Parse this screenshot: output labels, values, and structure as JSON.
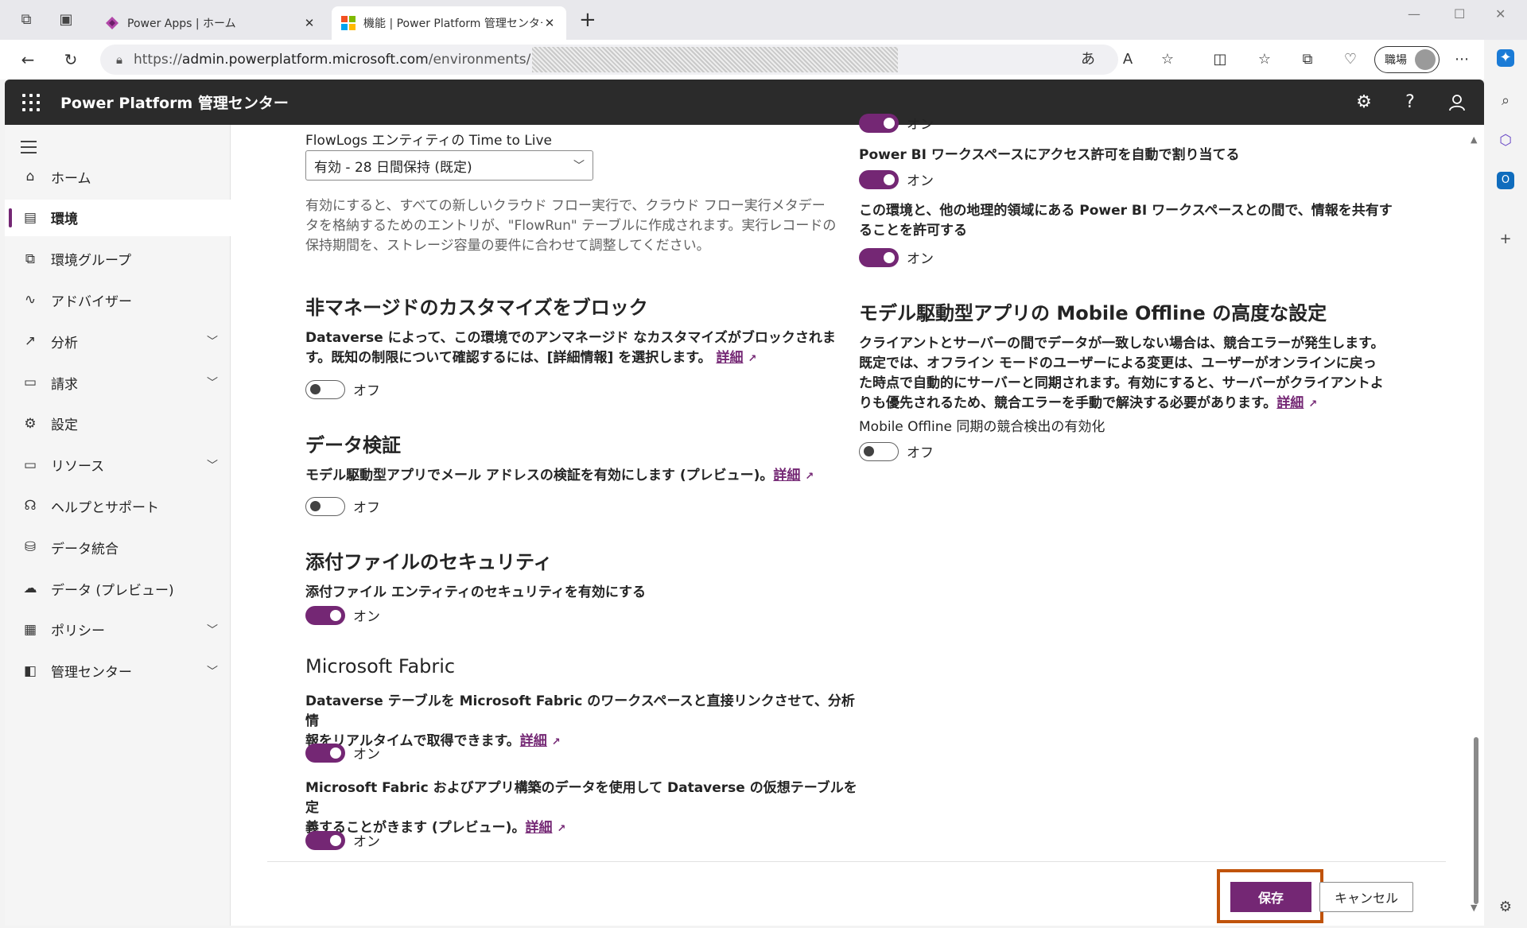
{
  "browser": {
    "tabs": [
      {
        "title": "Power Apps | ホーム",
        "favicon": "power-apps-icon",
        "active": false
      },
      {
        "title": "機能 | Power Platform 管理センター",
        "favicon": "microsoft-icon",
        "active": true
      }
    ],
    "url_prefix": "https://",
    "url_host": "admin.powerplatform.microsoft.com",
    "url_path": "/environments/",
    "profile_label": "職場"
  },
  "app": {
    "title": "Power Platform 管理センター"
  },
  "nav": {
    "items": [
      {
        "label": "ホーム",
        "icon": "home-icon",
        "glyph": "⌂",
        "expandable": false,
        "selected": false
      },
      {
        "label": "環境",
        "icon": "environment-icon",
        "glyph": "▤",
        "expandable": false,
        "selected": true
      },
      {
        "label": "環境グループ",
        "icon": "environment-group-icon",
        "glyph": "⧉",
        "expandable": false,
        "selected": false
      },
      {
        "label": "アドバイザー",
        "icon": "advisor-icon",
        "glyph": "∿",
        "expandable": false,
        "selected": false
      },
      {
        "label": "分析",
        "icon": "analytics-icon",
        "glyph": "↗",
        "expandable": true,
        "selected": false
      },
      {
        "label": "請求",
        "icon": "billing-icon",
        "glyph": "▭",
        "expandable": true,
        "selected": false
      },
      {
        "label": "設定",
        "icon": "settings-icon",
        "glyph": "⚙",
        "expandable": false,
        "selected": false
      },
      {
        "label": "リソース",
        "icon": "resources-icon",
        "glyph": "▭",
        "expandable": true,
        "selected": false
      },
      {
        "label": "ヘルプとサポート",
        "icon": "help-support-icon",
        "glyph": "☊",
        "expandable": false,
        "selected": false
      },
      {
        "label": "データ統合",
        "icon": "data-integration-icon",
        "glyph": "⛁",
        "expandable": false,
        "selected": false
      },
      {
        "label": "データ (プレビュー)",
        "icon": "data-preview-icon",
        "glyph": "☁",
        "expandable": false,
        "selected": false
      },
      {
        "label": "ポリシー",
        "icon": "policy-icon",
        "glyph": "▦",
        "expandable": true,
        "selected": false
      },
      {
        "label": "管理センター",
        "icon": "admin-center-icon",
        "glyph": "◧",
        "expandable": true,
        "selected": false
      }
    ]
  },
  "content": {
    "flowlogs": {
      "label": "FlowLogs エンティティの Time to Live",
      "select_value": "有効 - 28 日間保持 (既定)",
      "description_lines": [
        "有効にすると、すべての新しいクラウド フロー実行で、クラウド フロー実行メタデー",
        "タを格納するためのエントリが、\"FlowRun\" テーブルに作成されます。実行レコードの",
        "保持期間を、ストレージ容量の要件に合わせて調整してください。"
      ]
    },
    "block_unmanaged": {
      "heading": "非マネージドのカスタマイズをブロック",
      "line1": "Dataverse によって、この環境でのアンマネージド なカスタマイズがブロックされま",
      "line2": "す。既知の制限について確認するには、[詳細情報] を選択します。",
      "link": "詳細",
      "state": "オフ"
    },
    "data_validation": {
      "heading": "データ検証",
      "line1": "モデル駆動型アプリでメール アドレスの検証を有効にします (プレビュー)。",
      "link": "詳細",
      "state": "オフ"
    },
    "attachment_security": {
      "heading": "添付ファイルのセキュリティ",
      "label": "添付ファイル エンティティのセキュリティを有効にする",
      "state": "オン"
    },
    "fabric": {
      "heading": "Microsoft Fabric",
      "item1_line1": "Dataverse テーブルを Microsoft Fabric のワークスペースと直接リンクさせて、分析情",
      "item1_line2": "報をリアルタイムで取得できます。",
      "item1_link": "詳細",
      "item1_state": "オン",
      "item2_line1": "Microsoft Fabric およびアプリ構築のデータを使用して Dataverse の仮想テーブルを定",
      "item2_line2": "義することがきます (プレビュー)。",
      "item2_link": "詳細",
      "item2_state": "オン"
    },
    "powerbi": {
      "partial_state": "オン",
      "workspace_label": "Power BI ワークスペースにアクセス許可を自動で割り当てる",
      "workspace_state": "オン",
      "share_line1": "この環境と、他の地理的領域にある Power BI ワークスペースとの間で、情報を共有す",
      "share_line2": "ることを許可する",
      "share_state": "オン"
    },
    "mobile_offline": {
      "heading": "モデル駆動型アプリの Mobile Offline の高度な設定",
      "lines": [
        "クライアントとサーバーの間でデータが一致しない場合は、競合エラーが発生します。",
        "既定では、オフライン モードのユーザーによる変更は、ユーザーがオンラインに戻っ",
        "た時点で自動的にサーバーと同期されます。有効にすると、サーバーがクライアントよ"
      ],
      "last_line": "りも優先されるため、競合エラーを手動で解決する必要があります。",
      "link": "詳細",
      "conflict_label": "Mobile Offline 同期の競合検出の有効化",
      "conflict_state": "オフ"
    }
  },
  "footer": {
    "save_label": "保存",
    "cancel_label": "キャンセル"
  },
  "colors": {
    "accent": "#742774",
    "highlight_box": "#c0530b",
    "appbar": "#2b2b2b"
  }
}
